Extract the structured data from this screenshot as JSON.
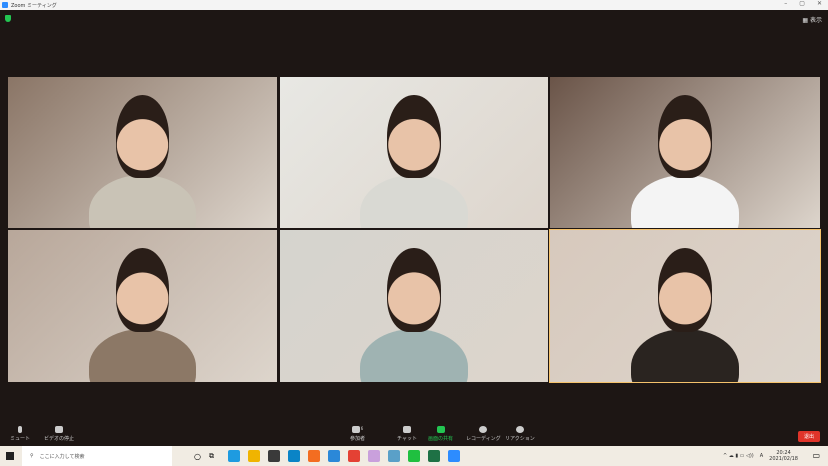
{
  "window": {
    "title": "Zoom ミーティング",
    "view_label": "表示",
    "controls": [
      "–",
      "▢",
      "✕"
    ]
  },
  "participants": [
    {
      "bg": "#8a7566",
      "shirt": "#c9c3b6"
    },
    {
      "bg": "#e8e8e4",
      "shirt": "#d9d9d3"
    },
    {
      "bg": "#6a5448",
      "shirt": "#f4f4f4"
    },
    {
      "bg": "#b8a79a",
      "shirt": "#8c7866"
    },
    {
      "bg": "#d5d4ce",
      "shirt": "#9fb3b2"
    },
    {
      "bg": "#d7c9bd",
      "shirt": "#2a2420",
      "active": true
    }
  ],
  "toolbar": {
    "mute": "ミュート",
    "video": "ビデオの停止",
    "participants": "参加者",
    "participant_count": "6",
    "chat": "チャット",
    "share": "画面の共有",
    "record": "レコーディング",
    "reactions": "リアクション",
    "leave": "退出"
  },
  "taskbar": {
    "search_placeholder": "ここに入力して検索",
    "time": "20:24",
    "date": "2021/02/18",
    "ime": "A",
    "apps": [
      "#1e9be0",
      "#f0b400",
      "#3a3a3a",
      "#0a84c6",
      "#f36d21",
      "#2b88d8",
      "#e44134",
      "#c9a0dc",
      "#5aa0c8",
      "#20c040",
      "#1e7145",
      "#2d8cff"
    ]
  }
}
